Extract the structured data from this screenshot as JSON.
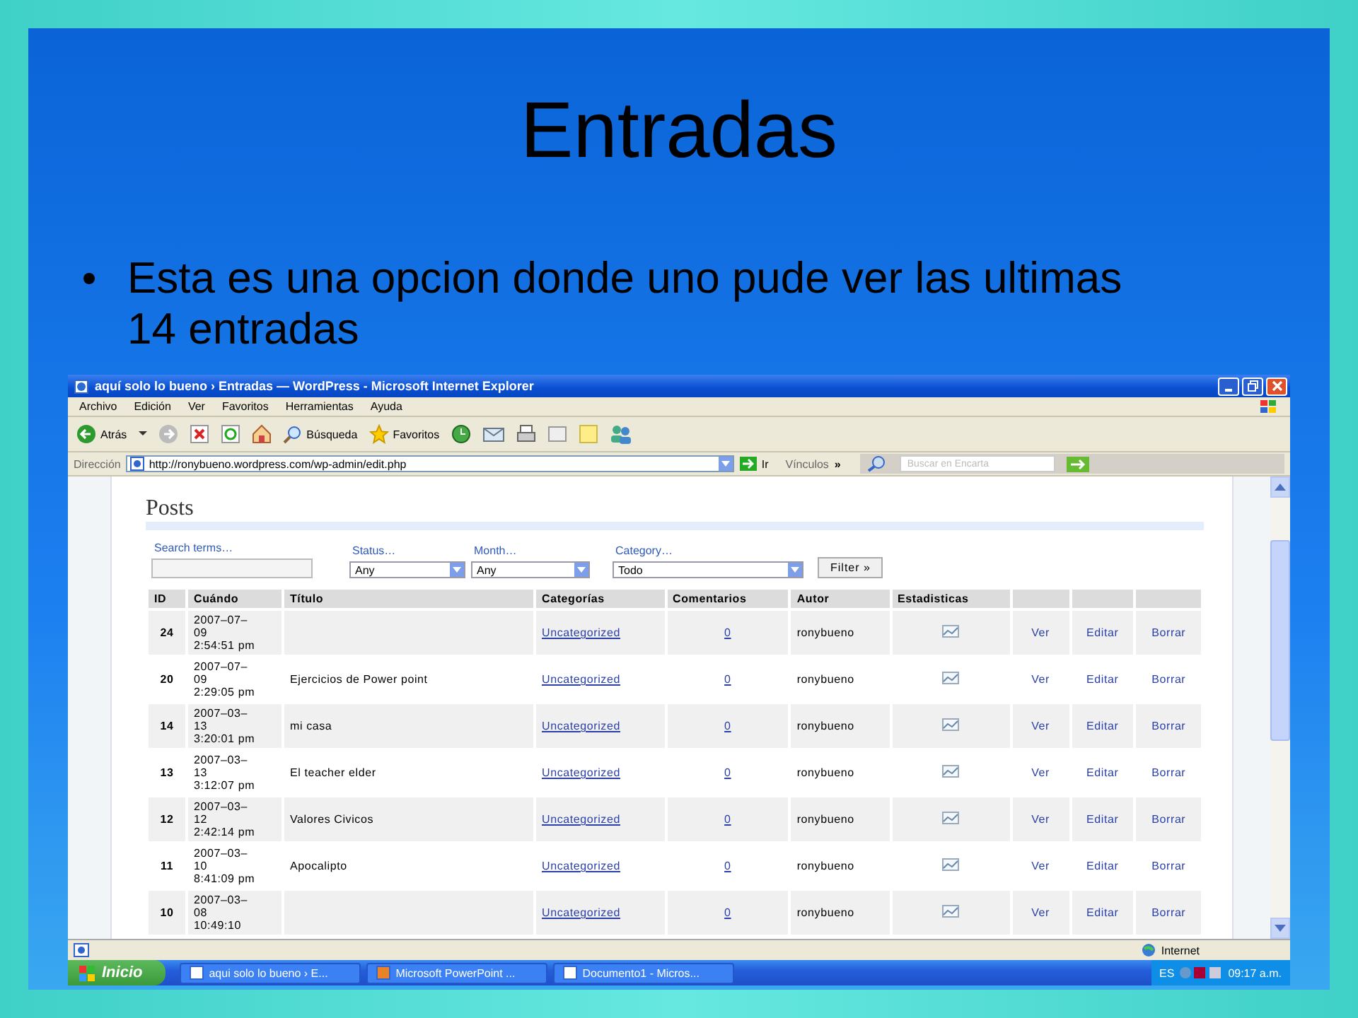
{
  "slide": {
    "title": "Entradas",
    "bullet": "Esta es una opcion donde uno pude ver las ultimas 14 entradas"
  },
  "window": {
    "title": "aquí solo lo bueno › Entradas — WordPress - Microsoft Internet Explorer"
  },
  "menu": [
    "Archivo",
    "Edición",
    "Ver",
    "Favoritos",
    "Herramientas",
    "Ayuda"
  ],
  "toolbar": {
    "back": "Atrás",
    "search": "Búsqueda",
    "favorites": "Favoritos"
  },
  "address": {
    "label": "Dirección",
    "url": "http://ronybueno.wordpress.com/wp-admin/edit.php",
    "go": "Ir",
    "links": "Vínculos",
    "chevron": "»",
    "search_placeholder": "Buscar en Encarta"
  },
  "page": {
    "heading": "Posts",
    "filters": [
      {
        "label": "Search terms…",
        "kind": "text"
      },
      {
        "label": "Status…",
        "kind": "select",
        "value": "Any"
      },
      {
        "label": "Month…",
        "kind": "select",
        "value": "Any"
      },
      {
        "label": "Category…",
        "kind": "select",
        "value": "Todo"
      }
    ],
    "filter_button": "Filter »",
    "table": {
      "columns": [
        "ID",
        "Cuándo",
        "Título",
        "Categorías",
        "Comentarios",
        "Autor",
        "Estadisticas"
      ],
      "rows": [
        {
          "id": "24",
          "when": [
            "2007–07–",
            "09",
            "2:54:51 pm"
          ],
          "category": "Uncategorized",
          "comments": "0",
          "author": "ronybueno",
          "actions": [
            "Ver",
            "Editar",
            "Borrar"
          ]
        },
        {
          "id": "20",
          "when": [
            "2007–07–",
            "09",
            "2:29:05 pm"
          ],
          "title": "Ejercicios de Power point",
          "category": "Uncategorized",
          "comments": "0",
          "author": "ronybueno",
          "actions": [
            "Ver",
            "Editar",
            "Borrar"
          ]
        },
        {
          "id": "14",
          "when": [
            "2007–03–",
            "13",
            "3:20:01 pm"
          ],
          "title": "mi casa",
          "category": "Uncategorized",
          "comments": "0",
          "author": "ronybueno",
          "actions": [
            "Ver",
            "Editar",
            "Borrar"
          ]
        },
        {
          "id": "13",
          "when": [
            "2007–03–",
            "13",
            "3:12:07 pm"
          ],
          "title": "El teacher elder",
          "category": "Uncategorized",
          "comments": "0",
          "author": "ronybueno",
          "actions": [
            "Ver",
            "Editar",
            "Borrar"
          ]
        },
        {
          "id": "12",
          "when": [
            "2007–03–",
            "12",
            "2:42:14 pm"
          ],
          "title": "Valores Civicos",
          "category": "Uncategorized",
          "comments": "0",
          "author": "ronybueno",
          "actions": [
            "Ver",
            "Editar",
            "Borrar"
          ]
        },
        {
          "id": "11",
          "when": [
            "2007–03–",
            "10",
            "8:41:09 pm"
          ],
          "title": "Apocalipto",
          "category": "Uncategorized",
          "comments": "0",
          "author": "ronybueno",
          "actions": [
            "Ver",
            "Editar",
            "Borrar"
          ]
        },
        {
          "id": "10",
          "when": [
            "2007–03–",
            "08",
            "10:49:10"
          ],
          "category": "Uncategorized",
          "comments": "0",
          "author": "ronybueno",
          "actions": [
            "Ver",
            "Editar",
            "Borrar"
          ]
        }
      ]
    }
  },
  "status_bar": {
    "zone": "Internet"
  },
  "taskbar": {
    "start": "Inicio",
    "tasks": [
      {
        "label": "aqui solo lo bueno › E...",
        "selected": false
      },
      {
        "label": "Microsoft PowerPoint ...",
        "selected": false
      },
      {
        "label": "Documento1 - Micros...",
        "selected": false
      }
    ],
    "lang": "ES",
    "time": "09:17 a.m."
  }
}
